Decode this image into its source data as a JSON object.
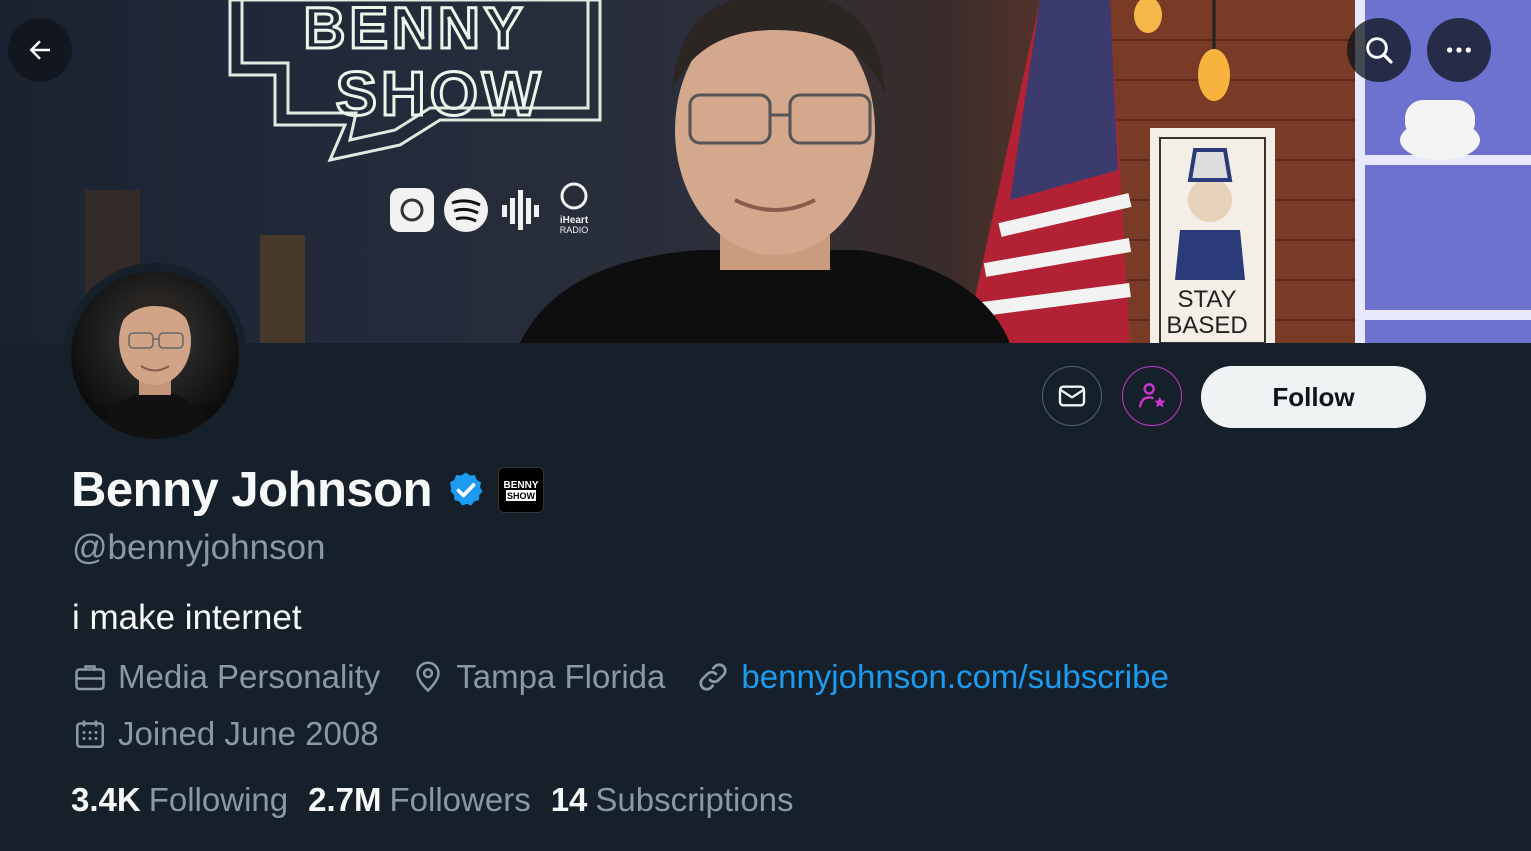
{
  "banner": {
    "neon_line1": "BENNY",
    "neon_line2": "SHOW",
    "radio_label_1": "iHeart",
    "radio_label_2": "RADIO",
    "poster_line1": "STAY",
    "poster_line2": "BASED"
  },
  "nav": {
    "back_icon": "arrow-left-icon",
    "search_icon": "search-icon",
    "more_icon": "more-icon"
  },
  "profile": {
    "name": "Benny Johnson",
    "handle": "@bennyjohnson",
    "bio": "i make internet",
    "affiliate_badge_line1": "BENNY",
    "affiliate_badge_line2": "SHOW",
    "category": "Media Personality",
    "location": "Tampa Florida",
    "website": "bennyjohnson.com/subscribe",
    "joined": "Joined June 2008"
  },
  "actions": {
    "follow_label": "Follow"
  },
  "stats": {
    "following_count": "3.4K",
    "following_label": "Following",
    "followers_count": "2.7M",
    "followers_label": "Followers",
    "subscriptions_count": "14",
    "subscriptions_label": "Subscriptions"
  },
  "colors": {
    "background": "#15202b",
    "secondary_text": "#8b98a5",
    "link": "#1d9bf0",
    "verified": "#1d9bf0",
    "subscribe_accent": "#c936cc",
    "follow_button": "#eff3f4"
  }
}
